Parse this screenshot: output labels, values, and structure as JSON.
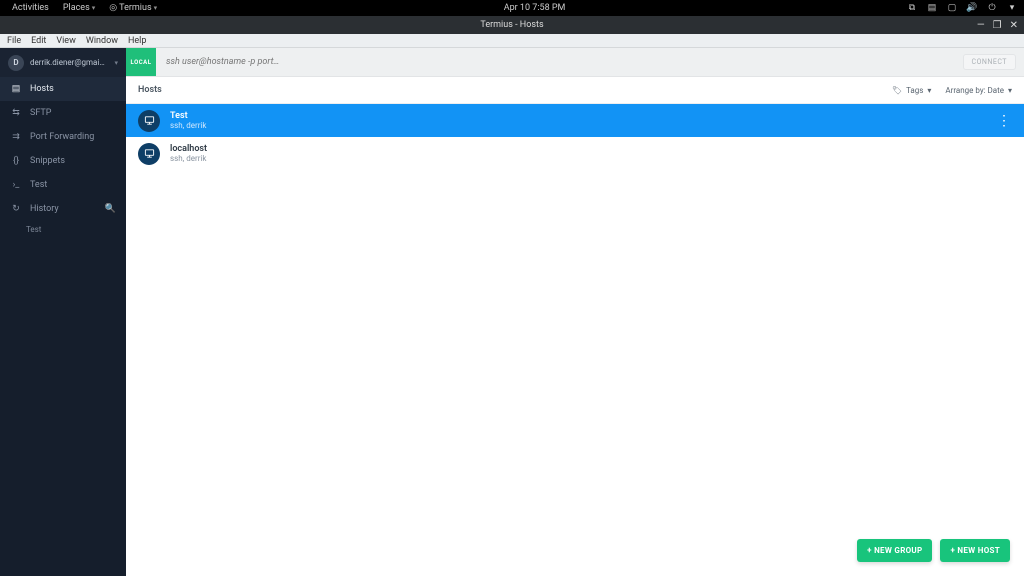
{
  "gnome": {
    "activities": "Activities",
    "places": "Places",
    "app": "Termius",
    "datetime": "Apr 10  7:58 PM"
  },
  "window": {
    "title": "Termius - Hosts"
  },
  "menu": {
    "file": "File",
    "edit": "Edit",
    "view": "View",
    "window": "Window",
    "help": "Help"
  },
  "account": {
    "initial": "D",
    "email": "derrik.diener@gmail.com"
  },
  "sidebar": {
    "hosts": "Hosts",
    "sftp": "SFTP",
    "portfwd": "Port Forwarding",
    "snippets": "Snippets",
    "test": "Test",
    "history": "History",
    "history_items": {
      "0": "Test"
    }
  },
  "quick": {
    "local": "LOCAL",
    "placeholder": "ssh user@hostname -p port…",
    "connect": "CONNECT"
  },
  "list": {
    "title": "Hosts",
    "tags": "Tags",
    "arrange": "Arrange by: Date"
  },
  "hosts": [
    {
      "name": "Test",
      "sub": "ssh, derrik"
    },
    {
      "name": "localhost",
      "sub": "ssh, derrik"
    }
  ],
  "fab": {
    "group": "+ NEW GROUP",
    "host": "+ NEW HOST"
  }
}
